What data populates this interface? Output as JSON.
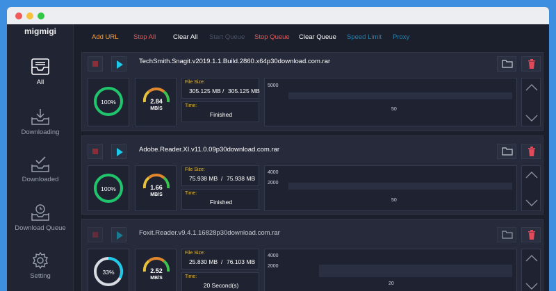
{
  "app": {
    "logo": "migmigi"
  },
  "sidebar": {
    "items": [
      {
        "label": "All",
        "icon": "inbox-icon",
        "active": true
      },
      {
        "label": "Downloading",
        "icon": "download-tray-icon",
        "active": false
      },
      {
        "label": "Downloaded",
        "icon": "downloaded-tray-icon",
        "active": false
      },
      {
        "label": "Download Queue",
        "icon": "queue-clock-icon",
        "active": false
      },
      {
        "label": "Setting",
        "icon": "gear-icon",
        "active": false
      }
    ]
  },
  "toolbar": {
    "add_url": "Add URL",
    "stop_all": "Stop All",
    "clear_all": "Clear All",
    "start_queue": "Start Queue",
    "stop_queue": "Stop Queue",
    "clear_queue": "Clear Queue",
    "speed_limit": "Speed Limit",
    "proxy": "Proxy"
  },
  "colors": {
    "accent_cyan": "#1ec8e8",
    "progress_green": "#1fc46b",
    "label_gold": "#e0b83c",
    "danger_red": "#e24a5a",
    "toolbar_orange": "#f0a040",
    "toolbar_red": "#e05a5a"
  },
  "downloads": [
    {
      "filename": "TechSmith.Snagit.v2019.1.1.Build.2860.x64p30download.com.rar",
      "progress_label": "100%",
      "progress": 1.0,
      "speed": "2.84",
      "speed_unit": "MB/S",
      "file_size_label": "File Size:",
      "downloaded": "305.125 MB",
      "separator": "/",
      "total": "305.125 MB",
      "time_label": "Time:",
      "time": "Finished",
      "chart_ticks_y": [
        "5000"
      ],
      "chart_tick_x": "50"
    },
    {
      "filename": "Adobe.Reader.XI.v11.0.09p30download.com.rar",
      "progress_label": "100%",
      "progress": 1.0,
      "speed": "1.66",
      "speed_unit": "MB/S",
      "file_size_label": "File Size:",
      "downloaded": "75.938 MB",
      "separator": "/",
      "total": "75.938 MB",
      "time_label": "Time:",
      "time": "Finished",
      "chart_ticks_y": [
        "4000",
        "2000"
      ],
      "chart_tick_x": "50"
    },
    {
      "filename": "Foxit.Reader.v9.4.1.16828p30download.com.rar",
      "progress_label": "33%",
      "progress": 0.33,
      "speed": "2.52",
      "speed_unit": "MB/S",
      "file_size_label": "File Size:",
      "downloaded": "25.830 MB",
      "separator": "/",
      "total": "76.103 MB",
      "time_label": "Time:",
      "time": "20 Second(s)",
      "chart_ticks_y": [
        "4000",
        "2000"
      ],
      "chart_tick_x": "20"
    }
  ]
}
